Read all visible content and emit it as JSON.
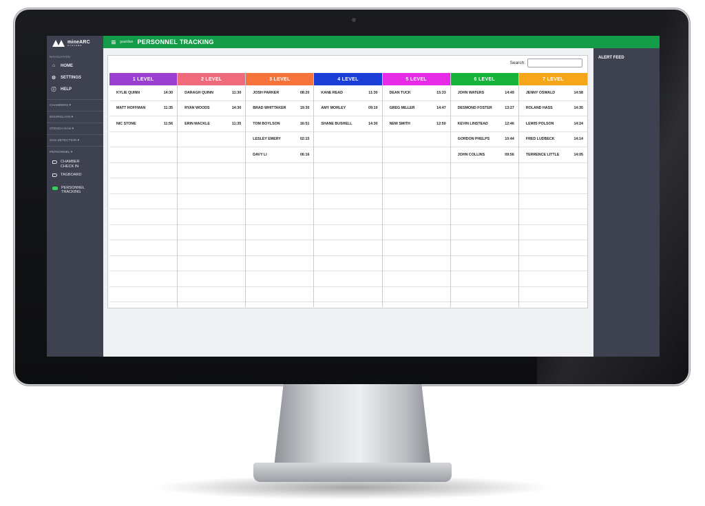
{
  "app": {
    "logo_text": "mineARC",
    "logo_subtext": "SYSTEMS",
    "brand_small": "guardian",
    "page_title": "PERSONNEL TRACKING"
  },
  "sidebar": {
    "heading": "NAVIGATION",
    "items": [
      {
        "label": "HOME",
        "icon": "home-icon"
      },
      {
        "label": "SETTINGS",
        "icon": "gear-icon"
      },
      {
        "label": "HELP",
        "icon": "info-icon"
      }
    ],
    "sections": [
      {
        "label": "CHAMBERS ▾"
      },
      {
        "label": "ENVIROLAVS ▾"
      },
      {
        "label": "STENCH GAS ▾"
      },
      {
        "label": "GAS DETECTION ▾"
      },
      {
        "label": "PERSONNEL ▾"
      }
    ],
    "sub_items": [
      {
        "label": "CHAMBER CHECK IN",
        "icon": "tag-icon"
      },
      {
        "label": "TAGBOARD",
        "icon": "tag-icon"
      },
      {
        "label": "PERSONNEL TRACKING",
        "icon": "active-indicator-icon"
      }
    ]
  },
  "search": {
    "label": "Search:",
    "value": "",
    "placeholder": ""
  },
  "alert_feed": {
    "title": "ALERT FEED"
  },
  "levels": [
    {
      "label": "1 LEVEL",
      "color": "#9b3fd0",
      "people": [
        {
          "name": "KYLIE QUINN",
          "time": "14:30"
        },
        {
          "name": "MATT HOFFMAN",
          "time": "11:35"
        },
        {
          "name": "NIC STONE",
          "time": "11:56"
        }
      ]
    },
    {
      "label": "2 LEVEL",
      "color": "#ef6a7b",
      "people": [
        {
          "name": "DARAGH QUINN",
          "time": "11:30"
        },
        {
          "name": "RYAN WOODS",
          "time": "14:30"
        },
        {
          "name": "ERIN MACKLE",
          "time": "11:35"
        }
      ]
    },
    {
      "label": "3 LEVEL",
      "color": "#f6743b",
      "people": [
        {
          "name": "JOSH PARKER",
          "time": "08:20"
        },
        {
          "name": "BRAD WHITTAKER",
          "time": "19:30"
        },
        {
          "name": "TOM BOYLSON",
          "time": "16:51"
        },
        {
          "name": "LESLEY EMERY",
          "time": "02:15"
        },
        {
          "name": "DAVY LI",
          "time": "06:16"
        }
      ]
    },
    {
      "label": "4 LEVEL",
      "color": "#1b3ed6",
      "people": [
        {
          "name": "KANE READ",
          "time": "11:30"
        },
        {
          "name": "AMY MORLEY",
          "time": "09:10"
        },
        {
          "name": "SHANE BUSHELL",
          "time": "14:30"
        }
      ]
    },
    {
      "label": "5 LEVEL",
      "color": "#e62be6",
      "people": [
        {
          "name": "DEAN TUCK",
          "time": "15:33"
        },
        {
          "name": "GREG MILLER",
          "time": "14:47"
        },
        {
          "name": "NEW SMITH",
          "time": "12:50"
        }
      ]
    },
    {
      "label": "6 LEVEL",
      "color": "#17b33a",
      "people": [
        {
          "name": "JOHN WATERS",
          "time": "14:49"
        },
        {
          "name": "DESMOND FOSTER",
          "time": "13:27"
        },
        {
          "name": "KEVIN LINSTEAD",
          "time": "12:46"
        },
        {
          "name": "GORDON PHELPS",
          "time": "10:44"
        },
        {
          "name": "JOHN COLLINS",
          "time": "09:56"
        }
      ]
    },
    {
      "label": "7 LEVEL",
      "color": "#f6a61b",
      "people": [
        {
          "name": "JENNY OSWALD",
          "time": "14:58"
        },
        {
          "name": "ROLAND HASS",
          "time": "14:35"
        },
        {
          "name": "LEWIS POLSON",
          "time": "14:24"
        },
        {
          "name": "FRED LUDBECK",
          "time": "14:14"
        },
        {
          "name": "TERRENCE LITTLE",
          "time": "14:05"
        }
      ]
    }
  ]
}
